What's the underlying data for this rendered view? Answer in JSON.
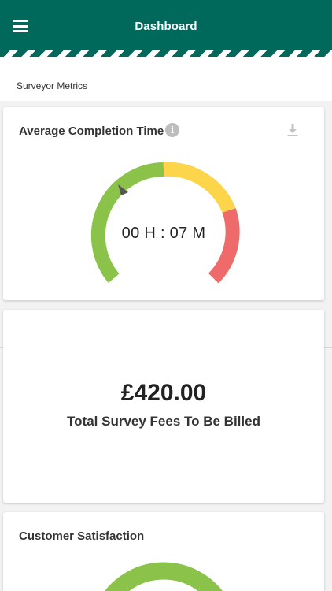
{
  "header": {
    "title": "Dashboard",
    "menu_icon": "hamburger-icon"
  },
  "subheader": {
    "label": "Surveyor Metrics"
  },
  "completion": {
    "title": "Average Completion Time",
    "info_icon": "info-icon",
    "info_glyph": "i",
    "download_icon": "download-icon",
    "time_text": "00 H : 07 M",
    "colors": {
      "green": "#8bc34a",
      "yellow": "#fdd54a",
      "red": "#ef6b6b"
    }
  },
  "fees": {
    "amount": "£420.00",
    "label": "Total Survey Fees To Be Billed"
  },
  "satisfaction": {
    "title": "Customer Satisfaction",
    "ring_color": "#8bc34a"
  }
}
